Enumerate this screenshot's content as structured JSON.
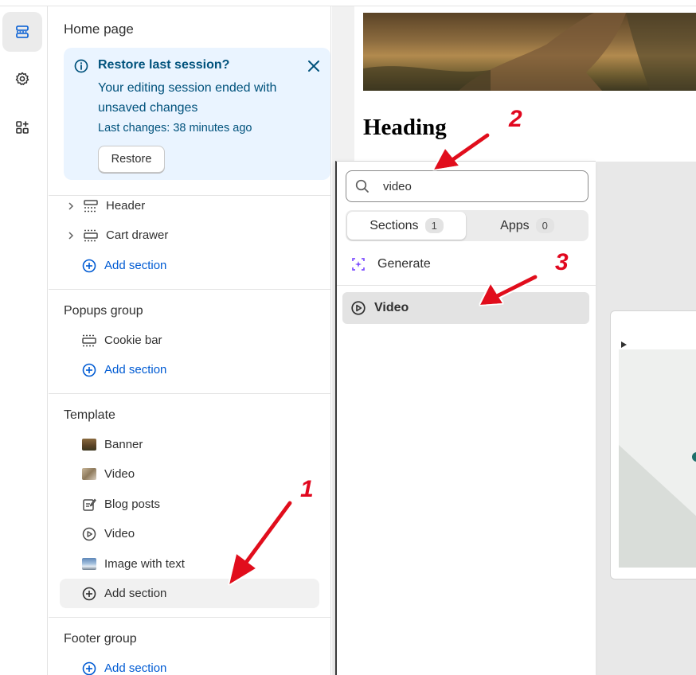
{
  "sidebar": {
    "page_title": "Home page",
    "restore_banner": {
      "title": "Restore last session?",
      "message": "Your editing session ended with unsaved changes",
      "last_changes": "Last changes: 38 minutes ago",
      "restore_label": "Restore"
    },
    "header_group": {
      "items": [
        {
          "label": "Header",
          "icon": "header-layout-icon"
        },
        {
          "label": "Cart drawer",
          "icon": "cart-drawer-layout-icon"
        }
      ],
      "add_section": "Add section"
    },
    "popups_group": {
      "title": "Popups group",
      "items": [
        {
          "label": "Cookie bar",
          "icon": "cookie-bar-layout-icon"
        }
      ],
      "add_section": "Add section"
    },
    "template": {
      "title": "Template",
      "items": [
        {
          "label": "Banner",
          "icon": "banner-thumbnail"
        },
        {
          "label": "Video",
          "icon": "video-thumbnail"
        },
        {
          "label": "Blog posts",
          "icon": "blog-posts-icon"
        },
        {
          "label": "Video",
          "icon": "play-circle-icon"
        },
        {
          "label": "Image with text",
          "icon": "image-with-text-thumbnail"
        }
      ],
      "add_section": "Add section"
    },
    "footer_group": {
      "title": "Footer group",
      "add_section": "Add section"
    }
  },
  "preview": {
    "heading": "Heading"
  },
  "popover": {
    "search_value": "video",
    "tabs": [
      {
        "label": "Sections",
        "count": "1"
      },
      {
        "label": "Apps",
        "count": "0"
      }
    ],
    "generate_label": "Generate",
    "results": [
      {
        "label": "Video",
        "icon": "play-circle-icon"
      }
    ]
  },
  "annotations": [
    "1",
    "2",
    "3"
  ],
  "colors": {
    "accent_link": "#005bd3",
    "banner_bg": "#eaf4ff",
    "annotation_red": "#e1081f"
  }
}
